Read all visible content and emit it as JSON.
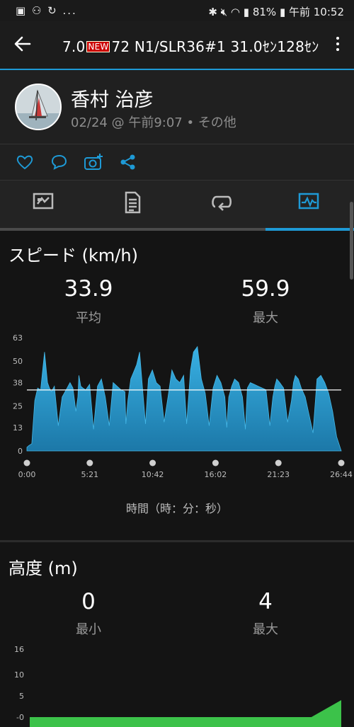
{
  "status_bar": {
    "left_icons": "▣ ⚇ ↻ ...",
    "battery": "81%",
    "time": "午前 10:52"
  },
  "app_bar": {
    "title_before": "7.0",
    "title_badge": "NEW",
    "title_after": "72 N1/SLR36#1 31.0ｾﾝ128ｾﾝ"
  },
  "activity": {
    "user_name": "香村 治彦",
    "meta": "02/24 @ 午前9:07 • その他"
  },
  "speed": {
    "title": "スピード (km/h)",
    "avg_value": "33.9",
    "avg_label": "平均",
    "max_value": "59.9",
    "max_label": "最大",
    "x_axis_label": "時間（時：分：秒）"
  },
  "elevation": {
    "title": "高度 (m)",
    "min_value": "0",
    "min_label": "最小",
    "max_value": "4",
    "max_label": "最大"
  },
  "colors": {
    "accent": "#1e9ad6",
    "speed_fill": "#2aa2d8",
    "elevation_fill": "#3cc24a"
  },
  "chart_data": [
    {
      "type": "area",
      "title": "スピード (km/h)",
      "xlabel": "時間（時：分：秒）",
      "ylabel": "",
      "x_ticks": [
        "0:00",
        "5:21",
        "10:42",
        "16:02",
        "21:23",
        "26:44"
      ],
      "y_ticks": [
        "0",
        "13",
        "25",
        "38",
        "50",
        "63"
      ],
      "ylim": [
        0,
        63
      ],
      "xlim_seconds": [
        0,
        1604
      ],
      "average_line": 33.9,
      "series": [
        {
          "x_seconds": [
            0,
            10,
            25,
            40,
            55,
            70,
            90,
            105,
            115,
            125,
            140,
            160,
            180,
            200,
            220,
            235,
            250,
            260,
            265,
            275,
            285,
            300,
            320,
            340,
            360,
            380,
            400,
            420,
            440,
            460,
            480,
            500,
            505,
            515,
            530,
            545,
            560,
            575,
            590,
            605,
            620,
            640,
            660,
            680,
            700,
            720,
            740,
            760,
            780,
            800,
            815,
            825,
            835,
            850,
            870,
            890,
            910,
            930,
            950,
            970,
            990,
            1010,
            1020,
            1030,
            1045,
            1060,
            1080,
            1100,
            1115,
            1125,
            1140,
            1160,
            1180,
            1200,
            1220,
            1240,
            1255,
            1265,
            1275,
            1290,
            1310,
            1330,
            1350,
            1360,
            1370,
            1385,
            1400,
            1420,
            1440,
            1460,
            1480,
            1500,
            1520,
            1540,
            1560,
            1580,
            1595,
            1604
          ],
          "values": [
            2,
            3,
            4,
            28,
            35,
            34,
            55,
            38,
            35,
            33,
            36,
            14,
            30,
            34,
            38,
            35,
            22,
            30,
            42,
            36,
            35,
            34,
            37,
            12,
            36,
            40,
            30,
            14,
            38,
            36,
            34,
            33,
            15,
            28,
            40,
            44,
            48,
            55,
            35,
            15,
            40,
            45,
            38,
            36,
            16,
            30,
            45,
            40,
            38,
            42,
            15,
            30,
            45,
            55,
            58,
            40,
            32,
            14,
            35,
            42,
            38,
            30,
            13,
            30,
            36,
            40,
            38,
            30,
            12,
            35,
            38,
            37,
            36,
            35,
            34,
            14,
            30,
            36,
            40,
            38,
            35,
            16,
            28,
            38,
            42,
            40,
            35,
            30,
            20,
            10,
            40,
            42,
            38,
            32,
            22,
            8,
            3,
            0
          ]
        }
      ]
    },
    {
      "type": "area",
      "title": "高度 (m)",
      "xlabel": "",
      "ylabel": "",
      "y_ticks": [
        "16",
        "10",
        "5",
        "-0"
      ],
      "ylim": [
        0,
        16
      ],
      "series": [
        {
          "x_seconds": [
            0,
            1450,
            1604
          ],
          "values": [
            0,
            0,
            4
          ]
        }
      ]
    }
  ]
}
